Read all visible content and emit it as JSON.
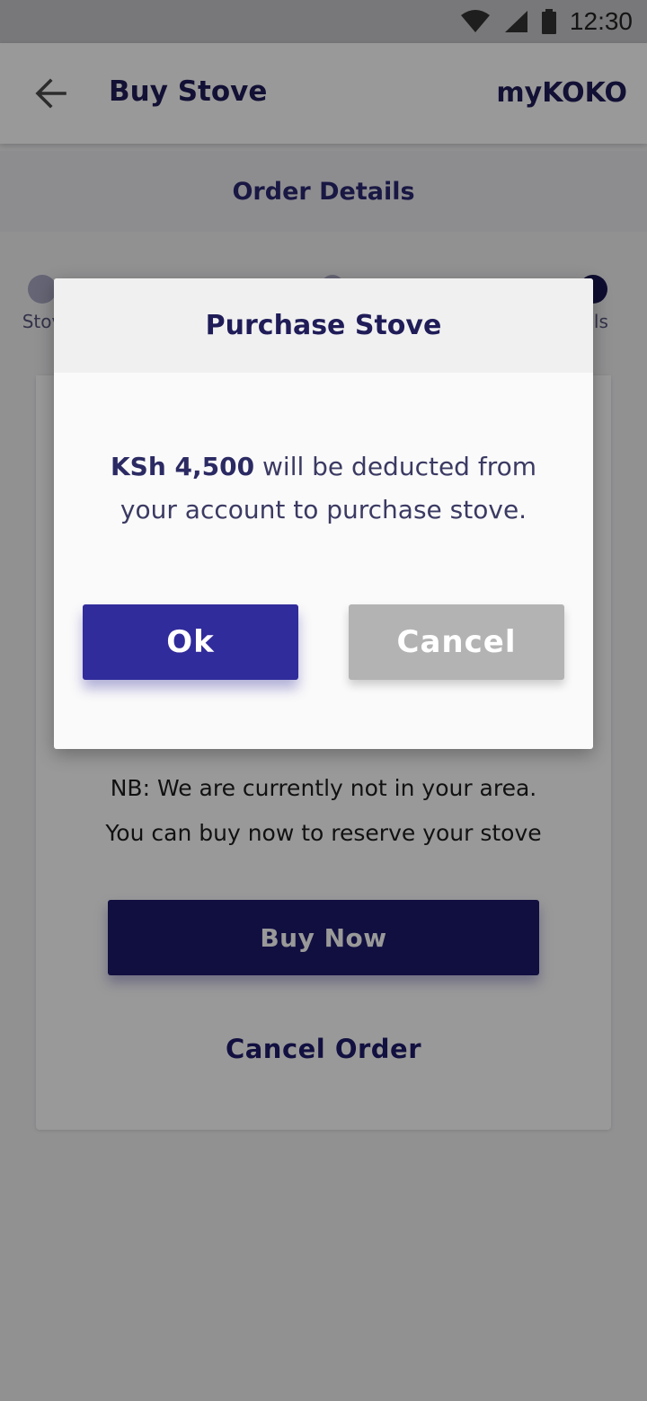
{
  "status_bar": {
    "time": "12:30",
    "icons": [
      "wifi-icon",
      "cell-signal-icon",
      "battery-icon"
    ]
  },
  "app_bar": {
    "title": "Buy Stove",
    "brand": "myKOKO",
    "back_icon": "arrow-left-icon"
  },
  "section": {
    "title": "Order Details"
  },
  "stepper": {
    "steps": [
      {
        "label": "Stov"
      },
      {
        "label": ""
      },
      {
        "label": "ails"
      }
    ]
  },
  "card": {
    "notice_line1": "NB: We are currently not in your area.",
    "notice_line2": "You can buy now to reserve your stove",
    "buy_now_label": "Buy Now",
    "cancel_order_label": "Cancel Order"
  },
  "dialog": {
    "title": "Purchase Stove",
    "amount": "KSh 4,500",
    "message_rest": " will be deducted from your account to purchase stove.",
    "ok_label": "Ok",
    "cancel_label": "Cancel"
  },
  "colors": {
    "primary": "#312c9b",
    "primary_dark": "#1d1a6b",
    "cancel_gray": "#b3b3b3",
    "text_dark": "#1f1c58"
  }
}
